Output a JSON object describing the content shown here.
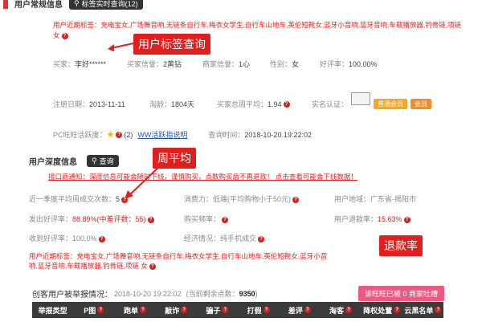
{
  "basic": {
    "title": "用户常规信息",
    "search_button": "标签实时查询(12)",
    "tags_label": "用户近期标签：",
    "tags_text_line1": "充电宝女,广场舞音响,无链条自行车,梅衣女学生,自行车山地车,英伦短靴女,蓝牙小音响,蓝牙音响,车载播放器,钓骨链,项链",
    "tags_text_line2": "女"
  },
  "callouts": {
    "tag_query": "用户标签查询",
    "weekly_avg": "周平均",
    "refund_rate": "退款率"
  },
  "profile_row1": [
    {
      "label": "买家：",
      "value": "李好******"
    },
    {
      "label": "买家信誉：",
      "value": "2黄钻"
    },
    {
      "label": "商家信誉：",
      "value": "1心"
    },
    {
      "label": "性别：",
      "value": "女"
    },
    {
      "label": "好评率：",
      "value": "100.00%"
    }
  ],
  "profile_row2": {
    "register_label": "注册日期：",
    "register_value": "2013-11-11",
    "age_label": "淘龄：",
    "age_value": "1804天",
    "weekly_label": "买家总周平均：",
    "weekly_value": "1.94",
    "realname_label": "实名认证：",
    "member_badge": "普通会员",
    "extra_badge": "会员"
  },
  "pc_row": {
    "label": "PC旺旺活跃度：",
    "count": "(2)",
    "link": "WW活跃指说明",
    "query_label": "查询时间：",
    "query_value": "2018-10-20 19:22:02"
  },
  "deep": {
    "title": "用户深度信息",
    "search_button": "查询",
    "notice": "接口商通知：深度信息可能会随时下线，谨慎购买，点数购买后不再退款！ 点击查看可能会下线数据！"
  },
  "deep_rows": [
    [
      {
        "label": "近一季度平均周成交次数：",
        "value": "5"
      },
      {
        "label": "消费力：",
        "value": "低端(平均购物小于50元)"
      },
      {
        "label": "用户地域：",
        "value": "广东省-揭阳市"
      }
    ],
    [
      {
        "label": "发出好评率：",
        "value": "88.89%(中差评数：55)"
      },
      {
        "label": "购买频率：",
        "value": ""
      },
      {
        "label": "用户退款率：",
        "value": "15.63%"
      }
    ],
    [
      {
        "label": "收到好评率：",
        "value": "100.0%"
      },
      {
        "label": "经济情况：",
        "value": "纯手机成交"
      }
    ]
  ],
  "deep_tags": {
    "label": "用户近期标签：",
    "line1": "充电宝女,广场舞音响,无链条自行车,梅衣女学生,自行车山地车,英伦短靴女,蓝牙小音",
    "line2": "响,蓝牙音响,车载播放器,钓骨链,项链 女"
  },
  "report": {
    "title": "创客用户被举报情况：",
    "time": "2018-10-20 19:22:02",
    "remaining_label": "(当前剩余点数：",
    "remaining_value": "9350",
    "remaining_close": ")",
    "badge": "该旺旺已被 0 商家吐槽"
  },
  "table_headers": [
    "举报类型",
    "P图",
    "跑单",
    "敲诈",
    "骗子",
    "打假",
    "差评",
    "淘客",
    "降权处置",
    "云黑名单"
  ],
  "colors": {
    "accent_red": "#e41d1d",
    "link_blue": "#2255aa",
    "dark": "#333333",
    "pink": "#ec5a83"
  }
}
